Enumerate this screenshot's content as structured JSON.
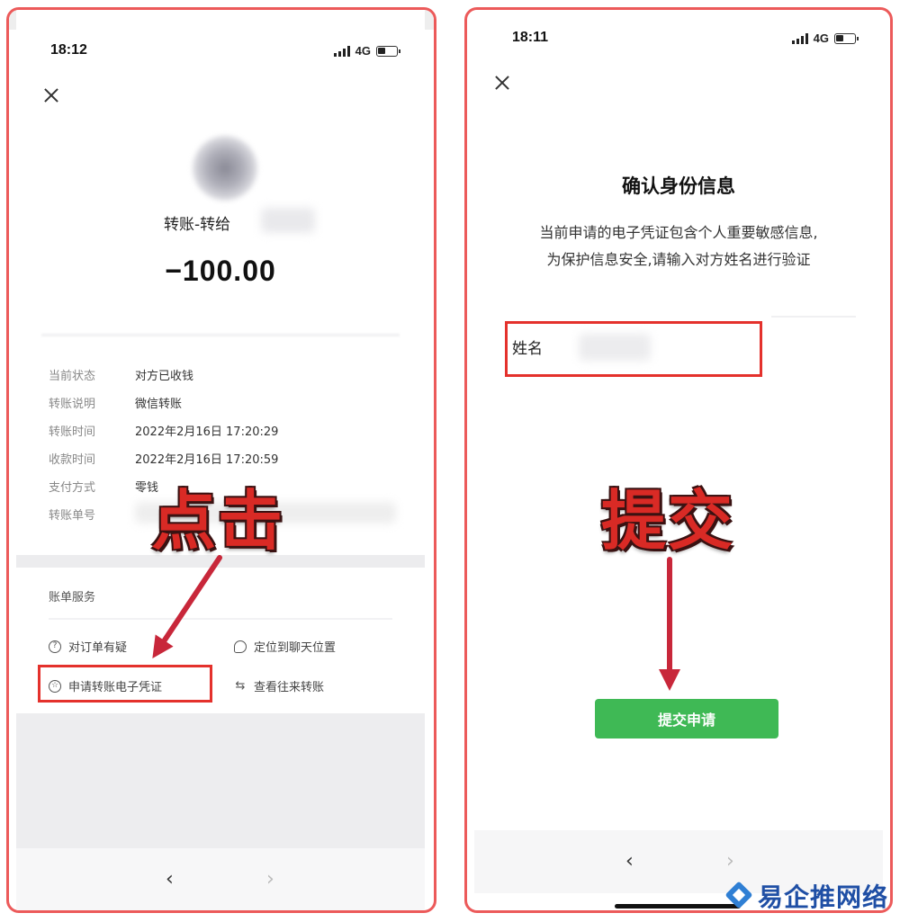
{
  "left_phone": {
    "status": {
      "time": "18:12",
      "network": "4G"
    },
    "transfer_title": "转账-转给",
    "amount": "−100.00",
    "details": [
      {
        "label": "当前状态",
        "value": "对方已收钱"
      },
      {
        "label": "转账说明",
        "value": "微信转账"
      },
      {
        "label": "转账时间",
        "value": "2022年2月16日 17:20:29"
      },
      {
        "label": "收款时间",
        "value": "2022年2月16日 17:20:59"
      },
      {
        "label": "支付方式",
        "value": "零钱"
      },
      {
        "label": "转账单号",
        "value": ""
      }
    ],
    "service_title": "账单服务",
    "services": {
      "question": "对订单有疑",
      "locate": "定位到聊天位置",
      "voucher": "申请转账电子凭证",
      "history": "查看往来转账"
    },
    "nav": {
      "back": "‹",
      "forward": "›"
    },
    "annotation": "点击"
  },
  "right_phone": {
    "status": {
      "time": "18:11",
      "network": "4G"
    },
    "title": "确认身份信息",
    "desc_line1": "当前申请的电子凭证包含个人重要敏感信息,",
    "desc_line2": "为保护信息安全,请输入对方姓名进行验证",
    "name_label": "姓名",
    "submit_label": "提交申请",
    "nav": {
      "back": "‹",
      "forward": "›"
    },
    "annotation": "提交"
  },
  "watermark": "易企推网络",
  "colors": {
    "frame": "#ec5a5a",
    "highlight": "#e4312c",
    "annotation": "#d92a25",
    "arrow": "#c8273a",
    "submit": "#3fb955",
    "watermark": "#1f4fa5"
  }
}
